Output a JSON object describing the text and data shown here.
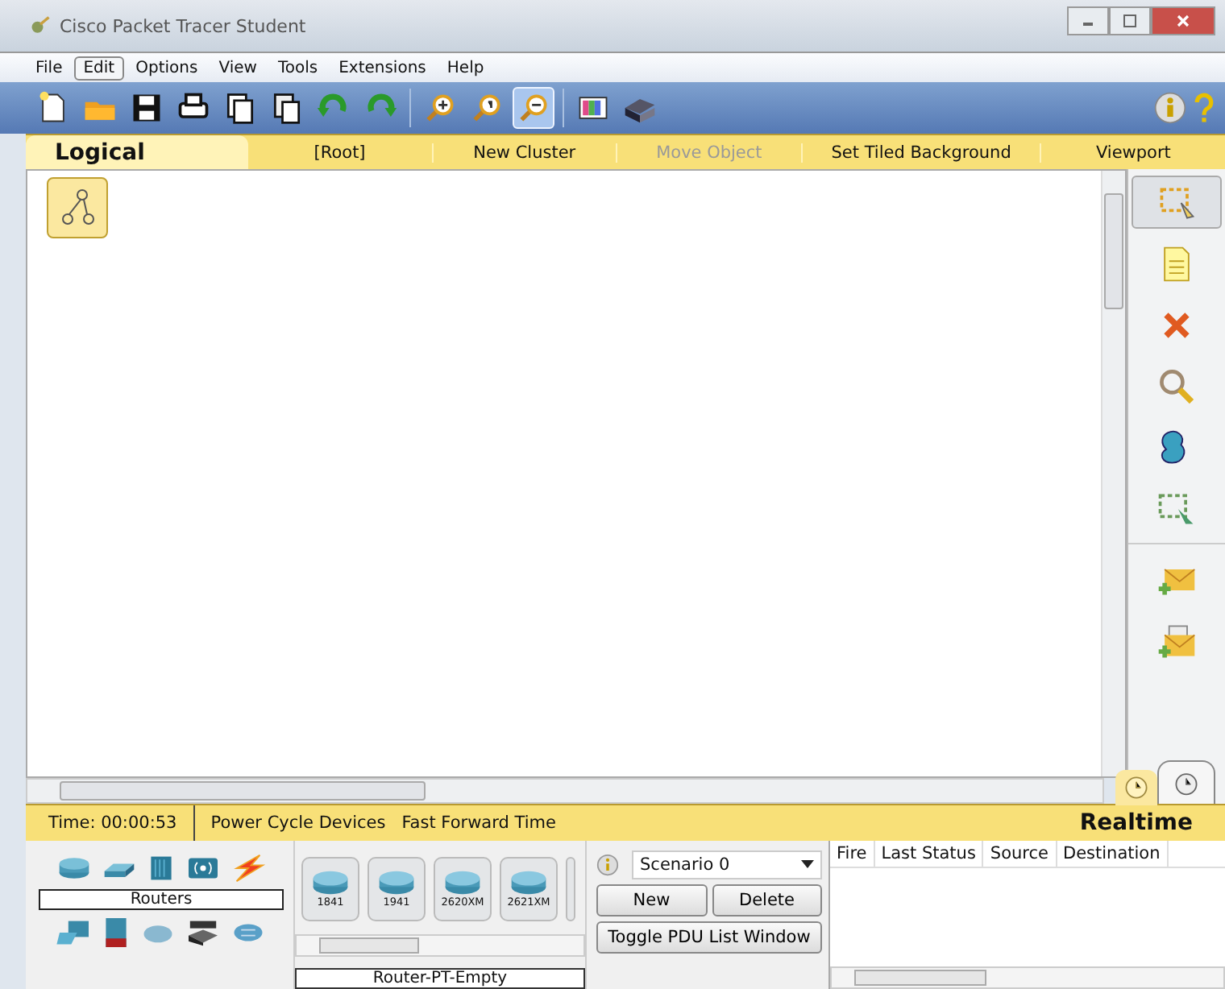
{
  "window": {
    "title": "Cisco Packet Tracer Student"
  },
  "menu": [
    {
      "label": "File",
      "selected": false
    },
    {
      "label": "Edit",
      "selected": true
    },
    {
      "label": "Options",
      "selected": false
    },
    {
      "label": "View",
      "selected": false
    },
    {
      "label": "Tools",
      "selected": false
    },
    {
      "label": "Extensions",
      "selected": false
    },
    {
      "label": "Help",
      "selected": false
    }
  ],
  "toolbar": [
    [
      {
        "kind": "new",
        "selected": false
      },
      {
        "kind": "open",
        "selected": false
      },
      {
        "kind": "save",
        "selected": false
      },
      {
        "kind": "print",
        "selected": false
      },
      {
        "kind": "copy",
        "selected": false
      },
      {
        "kind": "paste",
        "selected": false
      },
      {
        "kind": "undo",
        "selected": false
      },
      {
        "kind": "redo",
        "selected": false
      }
    ],
    [
      {
        "kind": "zoomin",
        "selected": false
      },
      {
        "kind": "zoomreset",
        "selected": false
      },
      {
        "kind": "zoomout",
        "selected": true
      }
    ],
    [
      {
        "kind": "palette",
        "selected": false
      },
      {
        "kind": "device",
        "selected": false
      }
    ]
  ],
  "workspace": {
    "tab": "Logical",
    "items": [
      {
        "label": "[Root]",
        "disabled": false
      },
      {
        "label": "New Cluster",
        "disabled": false
      },
      {
        "label": "Move Object",
        "disabled": true
      },
      {
        "label": "Set Tiled Background",
        "disabled": false
      },
      {
        "label": "Viewport",
        "disabled": false
      }
    ]
  },
  "tools": [
    [
      {
        "kind": "select",
        "selected": true
      },
      {
        "kind": "note",
        "selected": false
      },
      {
        "kind": "delete",
        "selected": false
      },
      {
        "kind": "inspect",
        "selected": false
      },
      {
        "kind": "shape",
        "selected": false
      },
      {
        "kind": "resize",
        "selected": false
      }
    ],
    [
      {
        "kind": "simple-pdu",
        "selected": false
      },
      {
        "kind": "complex-pdu",
        "selected": false
      }
    ]
  ],
  "status": {
    "time": "Time: 00:00:53",
    "buttons": [
      "Power Cycle Devices",
      "Fast Forward Time"
    ],
    "mode": "Realtime"
  },
  "devices": {
    "category": "Routers",
    "models": [
      "1841",
      "1941",
      "2620XM",
      "2621XM"
    ],
    "model_name": "Router-PT-Empty"
  },
  "scenario": {
    "value": "Scenario 0",
    "buttons": [
      "New",
      "Delete"
    ],
    "toggle": "Toggle PDU List Window"
  },
  "pdu_table": {
    "columns": [
      "Fire",
      "Last Status",
      "Source",
      "Destination"
    ]
  }
}
